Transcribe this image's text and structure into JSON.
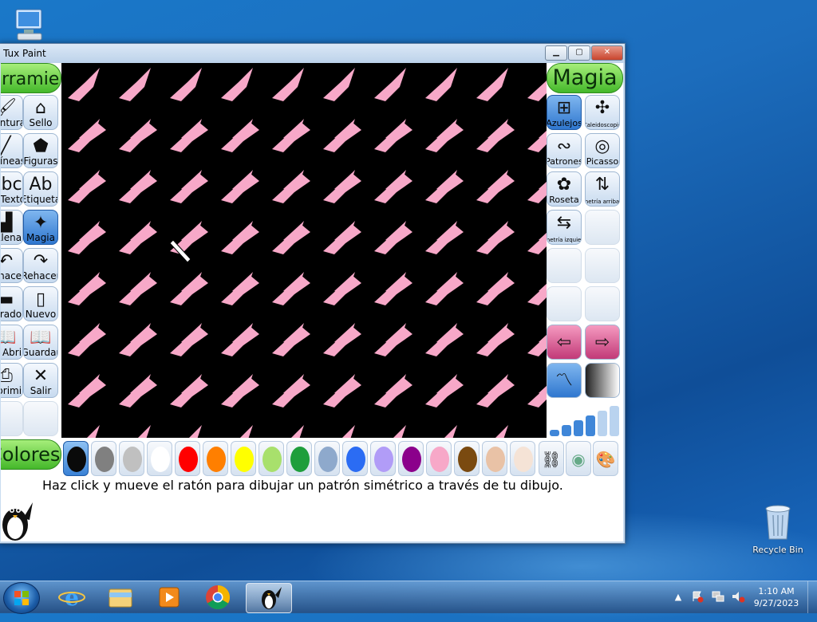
{
  "desktop": {
    "computer_icon": "computer-icon",
    "recycle_bin_label": "Recycle Bin"
  },
  "window": {
    "title": "Tux Paint",
    "minimize": "▁",
    "maximize": "▢",
    "close": "✕"
  },
  "tools": {
    "header": "Herramientas",
    "items": [
      {
        "label": "Pintura",
        "icon": "paint-icon"
      },
      {
        "label": "Sello",
        "icon": "stamp-icon"
      },
      {
        "label": "Líneas",
        "icon": "lines-icon"
      },
      {
        "label": "Figuras",
        "icon": "shapes-icon"
      },
      {
        "label": "Texto",
        "icon": "text-icon"
      },
      {
        "label": "Etiqueta",
        "icon": "label-icon"
      },
      {
        "label": "Llenar",
        "icon": "fill-icon"
      },
      {
        "label": "Magia",
        "icon": "magic-icon"
      },
      {
        "label": "Deshacer",
        "icon": "undo-icon"
      },
      {
        "label": "Rehacer",
        "icon": "redo-icon"
      },
      {
        "label": "Borrador",
        "icon": "eraser-icon"
      },
      {
        "label": "Nuevo",
        "icon": "new-icon"
      },
      {
        "label": "Abrir",
        "icon": "open-icon"
      },
      {
        "label": "Guardar",
        "icon": "save-icon"
      },
      {
        "label": "Imprimir",
        "icon": "print-icon"
      },
      {
        "label": "Salir",
        "icon": "quit-icon"
      }
    ]
  },
  "magic": {
    "header": "Magia",
    "items": [
      {
        "label": "Azulejos",
        "icon": "tiles-icon"
      },
      {
        "label": "Caleidoscopio",
        "icon": "kaleidoscope-icon"
      },
      {
        "label": "Patrones",
        "icon": "patterns-icon"
      },
      {
        "label": "Picasso",
        "icon": "picasso-icon"
      },
      {
        "label": "Roseta",
        "icon": "rosette-icon"
      },
      {
        "label": "Simetría arriba/abajo",
        "icon": "mirror-updown-icon"
      },
      {
        "label": "Simetría izquierda/derecha",
        "icon": "mirror-leftright-icon"
      }
    ],
    "prev_icon": "left-arrow-icon",
    "next_icon": "right-arrow-icon",
    "mode_paint_icon": "paint-mode-icon",
    "mode_fullscreen_icon": "fullscreen-mode-icon",
    "size_icon": "size-bars-icon"
  },
  "colors": {
    "header": "Colores",
    "swatches": [
      "#0a0a0a",
      "#808080",
      "#c0c0c0",
      "#ffffff",
      "#ff0000",
      "#ff7f00",
      "#ffff00",
      "#a8e06c",
      "#1e9e3c",
      "#8ea9cc",
      "#2b6cf3",
      "#b19cf7",
      "#8b008b",
      "#f7a8c8",
      "#7a4a10",
      "#e9c2a6",
      "#f5e3d6"
    ],
    "selected_index": 0,
    "rainbow_icon": "color-picker-icon",
    "palette_icon": "palette-icon",
    "dropper_icon": "eyedropper-icon"
  },
  "status": {
    "message": "Haz click y mueve el ratón para dibujar un patrón simétrico a través de tu dibujo.",
    "mascot_icon": "tux-penguin-icon"
  },
  "taskbar": {
    "time": "1:10 AM",
    "date": "9/27/2023",
    "apps": [
      "ie-icon",
      "explorer-icon",
      "media-player-icon",
      "chrome-icon",
      "tuxpaint-icon"
    ]
  }
}
